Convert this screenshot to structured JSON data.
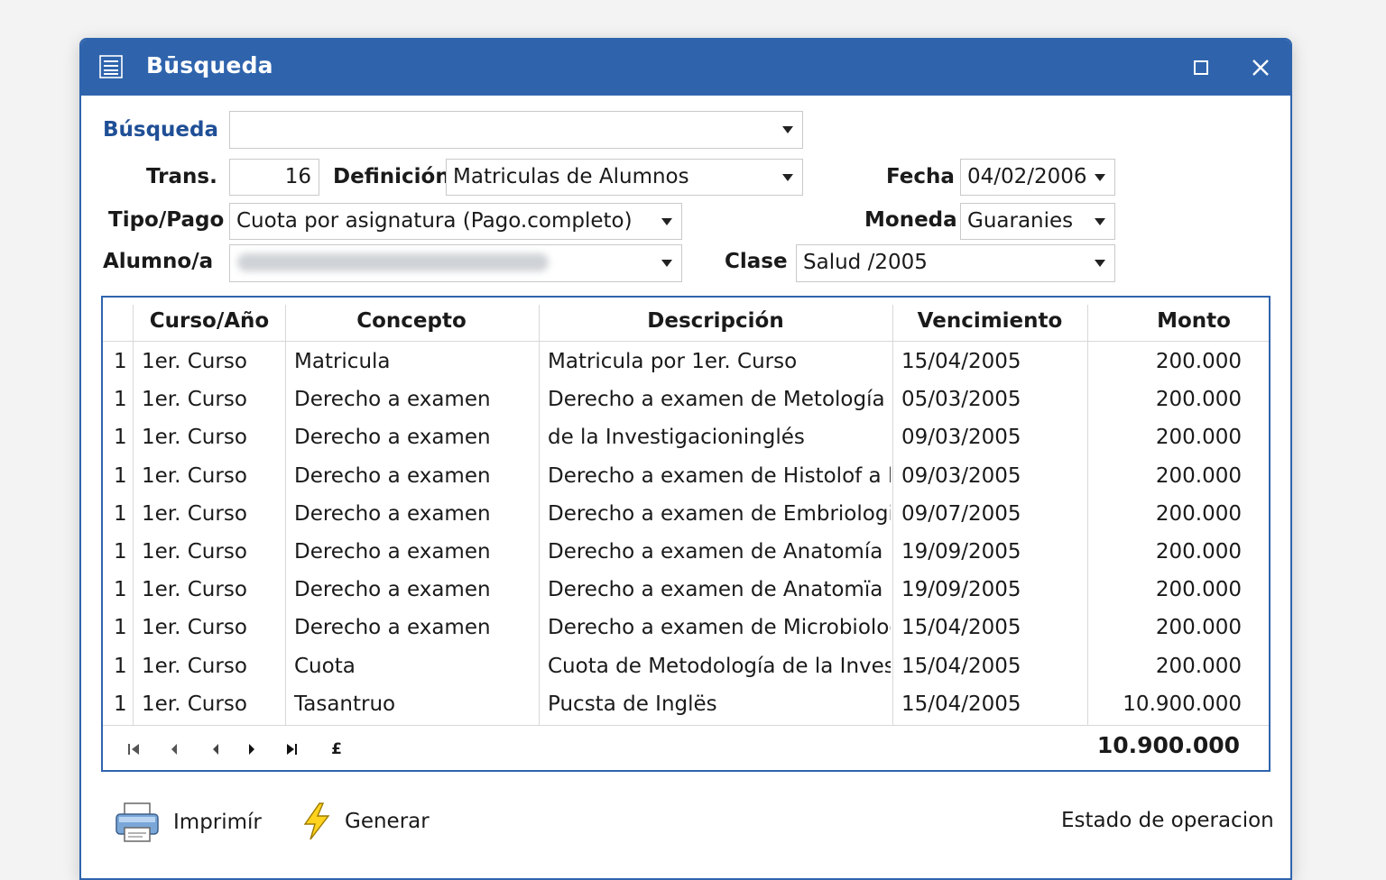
{
  "window": {
    "title": "Būsqueda",
    "icon": "list-icon",
    "accent": "#2f64ad"
  },
  "form": {
    "busqueda_label": "Búsqueda",
    "busqueda_value": "",
    "trans_label": "Trans.",
    "trans_value": "16",
    "definicion_label": "Definición",
    "definicion_value": "Matriculas de Alumnos",
    "fecha_label": "Fecha",
    "fecha_value": "04/02/2006",
    "tipopago_label": "Tipo/Pago",
    "tipopago_value": "Cuota por asignatura (Pago.completo)",
    "moneda_label": "Moneda",
    "moneda_value": "Guaranies",
    "alumno_label": "Alumno/a",
    "clase_label": "Clase",
    "clase_value": "Salud /2005"
  },
  "grid": {
    "columns": [
      "Curso/Año",
      "Concepto",
      "Descripción",
      "Vencimiento",
      "Monto"
    ],
    "rows": [
      [
        "1",
        "1er. Curso",
        "Matricula",
        "Matricula por 1er. Curso",
        "15/04/2005",
        "200.000"
      ],
      [
        "1",
        "1er. Curso",
        "Derecho a examen",
        "Derecho a examen de Metología",
        "05/03/2005",
        "200.000"
      ],
      [
        "1",
        "1er. Curso",
        "Derecho a examen",
        "de la Investigacioninglés",
        "09/03/2005",
        "200.000"
      ],
      [
        "1",
        "1er. Curso",
        "Derecho a examen",
        "Derecho a examen de Histolof a l",
        "09/03/2005",
        "200.000"
      ],
      [
        "1",
        "1er. Curso",
        "Derecho a examen",
        "Derecho a examen de Embriologia l",
        "09/07/2005",
        "200.000"
      ],
      [
        "1",
        "1er. Curso",
        "Derecho a examen",
        "Derecho a examen de Anatomía l",
        "19/09/2005",
        "200.000"
      ],
      [
        "1",
        "1er. Curso",
        "Derecho a examen",
        "Derecho a examen de Anatomïa ll",
        "19/09/2005",
        "200.000"
      ],
      [
        "1",
        "1er. Curso",
        "Derecho a examen",
        "Derecho a examen de Microbiologiä",
        "15/04/2005",
        "200.000"
      ],
      [
        "1",
        "1er. Curso",
        "Cuota",
        "Cuota de Metodología de la Investig",
        "15/04/2005",
        "200.000"
      ],
      [
        "1",
        "1er. Curso",
        "Tasantruo",
        "Pucsta de Inglës",
        "15/04/2005",
        "10.900.000"
      ]
    ],
    "nav_extra": "£",
    "total": "10.900.000"
  },
  "footer": {
    "print_label": "Imprimír",
    "print_icon": "printer-icon",
    "generate_label": "Generar",
    "generate_icon": "lightning-icon",
    "status": "Estado de operacion"
  }
}
